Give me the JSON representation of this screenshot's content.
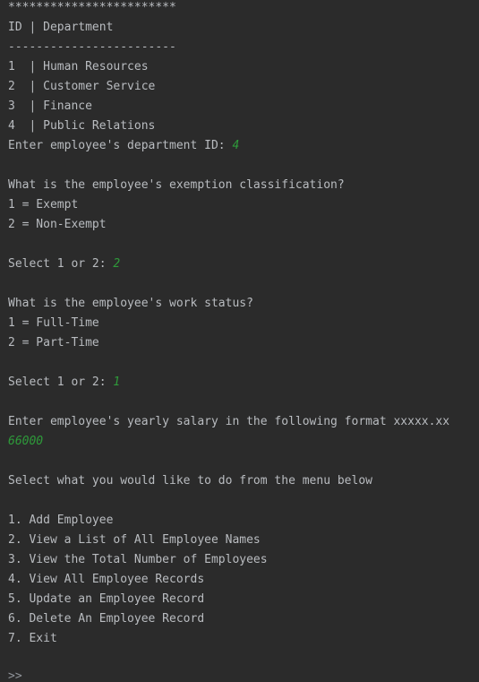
{
  "console": {
    "lines": [
      {
        "text": "************************",
        "input": ""
      },
      {
        "text": "ID | Department",
        "input": ""
      },
      {
        "text": "------------------------",
        "input": ""
      },
      {
        "text": "1  | Human Resources",
        "input": ""
      },
      {
        "text": "2  | Customer Service",
        "input": ""
      },
      {
        "text": "3  | Finance",
        "input": ""
      },
      {
        "text": "4  | Public Relations",
        "input": ""
      },
      {
        "text": "Enter employee's department ID: ",
        "input": "4"
      },
      {
        "text": "",
        "input": ""
      },
      {
        "text": "What is the employee's exemption classification?",
        "input": ""
      },
      {
        "text": "1 = Exempt",
        "input": ""
      },
      {
        "text": "2 = Non-Exempt",
        "input": ""
      },
      {
        "text": "",
        "input": ""
      },
      {
        "text": "Select 1 or 2: ",
        "input": "2"
      },
      {
        "text": "",
        "input": ""
      },
      {
        "text": "What is the employee's work status?",
        "input": ""
      },
      {
        "text": "1 = Full-Time",
        "input": ""
      },
      {
        "text": "2 = Part-Time",
        "input": ""
      },
      {
        "text": "",
        "input": ""
      },
      {
        "text": "Select 1 or 2: ",
        "input": "1"
      },
      {
        "text": "",
        "input": ""
      },
      {
        "text": "Enter employee's yearly salary in the following format xxxxx.xx",
        "input": ""
      },
      {
        "text": "",
        "input": "66000"
      },
      {
        "text": "",
        "input": ""
      },
      {
        "text": "Select what you would like to do from the menu below",
        "input": ""
      },
      {
        "text": "",
        "input": ""
      },
      {
        "text": "1. Add Employee",
        "input": ""
      },
      {
        "text": "2. View a List of All Employee Names",
        "input": ""
      },
      {
        "text": "3. View the Total Number of Employees",
        "input": ""
      },
      {
        "text": "4. View All Employee Records",
        "input": ""
      },
      {
        "text": "5. Update an Employee Record",
        "input": ""
      },
      {
        "text": "6. Delete An Employee Record",
        "input": ""
      },
      {
        "text": "7. Exit",
        "input": ""
      },
      {
        "text": "",
        "input": ""
      },
      {
        "text": ">>",
        "input": ""
      }
    ]
  },
  "colors": {
    "background": "#2b2b2b",
    "text": "#b9bcc0",
    "user_input": "#2e9a3a"
  }
}
